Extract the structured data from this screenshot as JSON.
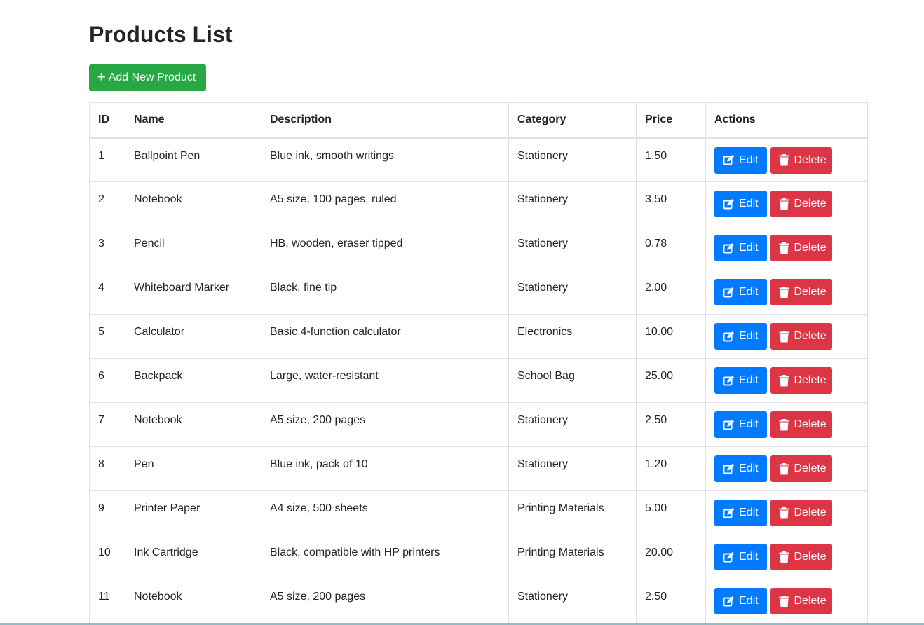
{
  "page": {
    "title": "Products List",
    "add_button_label": "Add New Product"
  },
  "table": {
    "columns": [
      "ID",
      "Name",
      "Description",
      "Category",
      "Price",
      "Actions"
    ],
    "edit_label": "Edit",
    "delete_label": "Delete",
    "rows": [
      {
        "id": "1",
        "name": "Ballpoint Pen",
        "description": "Blue ink, smooth writings",
        "category": "Stationery",
        "price": "1.50"
      },
      {
        "id": "2",
        "name": "Notebook",
        "description": "A5 size, 100 pages, ruled",
        "category": "Stationery",
        "price": "3.50"
      },
      {
        "id": "3",
        "name": "Pencil",
        "description": "HB, wooden, eraser tipped",
        "category": "Stationery",
        "price": "0.78"
      },
      {
        "id": "4",
        "name": "Whiteboard Marker",
        "description": "Black, fine tip",
        "category": "Stationery",
        "price": "2.00"
      },
      {
        "id": "5",
        "name": "Calculator",
        "description": "Basic 4-function calculator",
        "category": "Electronics",
        "price": "10.00"
      },
      {
        "id": "6",
        "name": "Backpack",
        "description": "Large, water-resistant",
        "category": "School Bag",
        "price": "25.00"
      },
      {
        "id": "7",
        "name": "Notebook",
        "description": "A5 size, 200 pages",
        "category": "Stationery",
        "price": "2.50"
      },
      {
        "id": "8",
        "name": "Pen",
        "description": "Blue ink, pack of 10",
        "category": "Stationery",
        "price": "1.20"
      },
      {
        "id": "9",
        "name": "Printer Paper",
        "description": "A4 size, 500 sheets",
        "category": "Printing Materials",
        "price": "5.00"
      },
      {
        "id": "10",
        "name": "Ink Cartridge",
        "description": "Black, compatible with HP printers",
        "category": "Printing Materials",
        "price": "20.00"
      },
      {
        "id": "11",
        "name": "Notebook",
        "description": "A5 size, 200 pages",
        "category": "Stationery",
        "price": "2.50"
      }
    ]
  },
  "icons": {
    "add": "plus-icon",
    "edit": "edit-icon",
    "delete": "trash-icon"
  },
  "colors": {
    "add_button": "#28a745",
    "edit_button": "#007bff",
    "delete_button": "#dc3545"
  }
}
